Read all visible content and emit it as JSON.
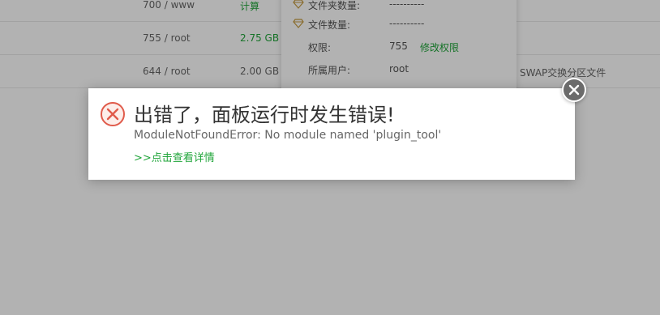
{
  "table": {
    "rows": [
      {
        "perm_owner": "700 / www",
        "size": "计算",
        "note": ""
      },
      {
        "perm_owner": "755 / root",
        "size": "2.75 GB",
        "note": ""
      },
      {
        "perm_owner": "644 / root",
        "size": "2.00 GB",
        "note": "SWAP交换分区文件"
      }
    ]
  },
  "popover": {
    "folder_count_label": "文件夹数量:",
    "folder_count_value": "----------",
    "file_count_label": "文件数量:",
    "file_count_value": "----------",
    "perm_label": "权限:",
    "perm_value": "755",
    "perm_action": "修改权限",
    "owner_label": "所属用户:",
    "owner_value": "root"
  },
  "dialog": {
    "title": "出错了，面板运行时发生错误!",
    "message": "ModuleNotFoundError: No module named 'plugin_tool'",
    "details_link": ">>点击查看详情",
    "icon": "error-x-icon",
    "close_icon": "close-icon"
  },
  "colors": {
    "accent_green": "#20a53a",
    "error_red": "#e05b4b",
    "overlay": "rgba(0,0,0,0.3)"
  }
}
